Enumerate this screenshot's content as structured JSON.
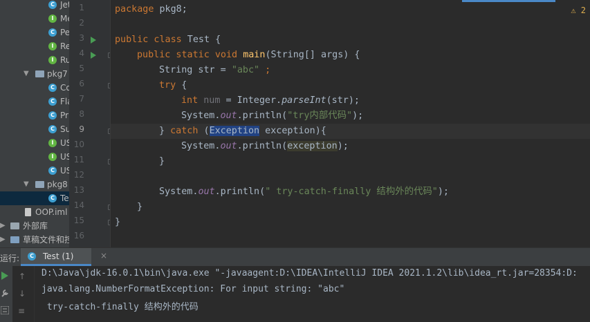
{
  "tree": {
    "rows": [
      {
        "kind": "c",
        "label": "Jet"
      },
      {
        "kind": "i",
        "label": "Me"
      },
      {
        "kind": "c",
        "label": "Pe"
      },
      {
        "kind": "i",
        "label": "Re"
      },
      {
        "kind": "i",
        "label": "Ru"
      },
      {
        "kind": "pkg",
        "label": "pkg7"
      },
      {
        "kind": "c",
        "label": "Co"
      },
      {
        "kind": "c",
        "label": "Fla"
      },
      {
        "kind": "c",
        "label": "Pri"
      },
      {
        "kind": "c",
        "label": "Su"
      },
      {
        "kind": "i",
        "label": "US"
      },
      {
        "kind": "i",
        "label": "US"
      },
      {
        "kind": "c",
        "label": "US"
      },
      {
        "kind": "pkg",
        "label": "pkg8"
      },
      {
        "kind": "c",
        "label": "Te"
      },
      {
        "kind": "file",
        "label": "OOP.iml"
      },
      {
        "kind": "lib",
        "label": "外部库"
      },
      {
        "kind": "scratch",
        "label": "草稿文件和控"
      }
    ]
  },
  "editor": {
    "line_numbers": [
      "1",
      "2",
      "3",
      "4",
      "5",
      "6",
      "7",
      "8",
      "9",
      "10",
      "11",
      "12",
      "13",
      "14",
      "15",
      "16"
    ],
    "warning_label": "⚠ 2",
    "code": {
      "l1": [
        "package",
        " pkg8;"
      ],
      "l3": [
        "public class",
        " Test {"
      ],
      "l4": [
        "public static void",
        " ",
        "main",
        "(String[] args) {"
      ],
      "l5": [
        "String str = ",
        "\"abc\"",
        " ;"
      ],
      "l6": [
        "try",
        " {"
      ],
      "l7": [
        "int",
        " ",
        "num",
        " = Integer.",
        "parseInt",
        "(str);"
      ],
      "l8": [
        "System.",
        "out",
        ".println(",
        "\"try内部代码\"",
        ");"
      ],
      "l9": [
        "} ",
        "catch",
        " (",
        "Exception",
        " exception){"
      ],
      "l10": [
        "System.",
        "out",
        ".println(",
        "exception",
        ");"
      ],
      "l11": [
        "}"
      ],
      "l13": [
        "System.",
        "out",
        ".println(",
        "\" try-catch-finally 结构外的代码\"",
        ");"
      ],
      "l14": [
        "}"
      ],
      "l15": [
        "}"
      ]
    }
  },
  "run_panel": {
    "label": "运行:",
    "tab_label": "Test (1)",
    "tab_close": "×",
    "output": [
      "D:\\Java\\jdk-16.0.1\\bin\\java.exe \"-javaagent:D:\\IDEA\\IntelliJ IDEA 2021.1.2\\lib\\idea_rt.jar=28354:D:",
      "java.lang.NumberFormatException: For input string: \"abc\"",
      " try-catch-finally 结构外的代码"
    ]
  },
  "colors": {
    "keyword": "#cc7832",
    "string": "#6a8759",
    "function": "#ffc66d",
    "field": "#9876aa",
    "text": "#a9b7c6",
    "error": "#ff6b68",
    "accent": "#4a88c7"
  }
}
